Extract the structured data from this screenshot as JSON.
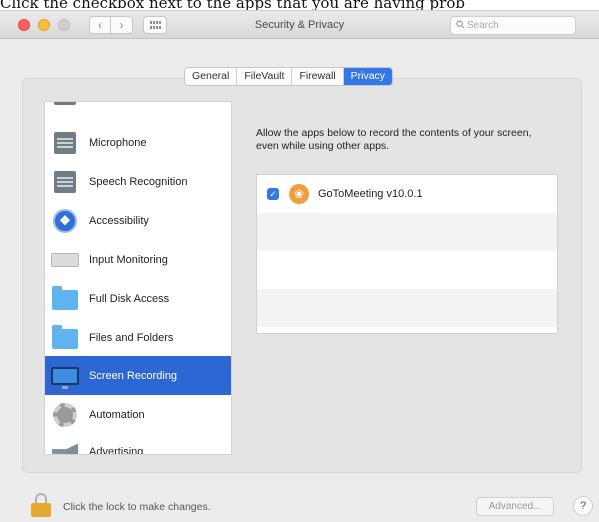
{
  "instruction_text": "Click the checkbox next to the apps that you are having prob",
  "window": {
    "title": "Security & Privacy",
    "search_placeholder": "Search"
  },
  "tabs": [
    {
      "label": "General",
      "selected": false
    },
    {
      "label": "FileVault",
      "selected": false
    },
    {
      "label": "Firewall",
      "selected": false
    },
    {
      "label": "Privacy",
      "selected": true
    }
  ],
  "sidebar": {
    "items": [
      {
        "label": "Microphone",
        "icon": "microphone-icon",
        "selected": false
      },
      {
        "label": "Speech Recognition",
        "icon": "speech-recognition-icon",
        "selected": false
      },
      {
        "label": "Accessibility",
        "icon": "accessibility-icon",
        "selected": false
      },
      {
        "label": "Input Monitoring",
        "icon": "keyboard-icon",
        "selected": false
      },
      {
        "label": "Full Disk Access",
        "icon": "folder-icon",
        "selected": false
      },
      {
        "label": "Files and Folders",
        "icon": "folder-icon",
        "selected": false
      },
      {
        "label": "Screen Recording",
        "icon": "monitor-icon",
        "selected": true
      },
      {
        "label": "Automation",
        "icon": "gear-icon",
        "selected": false
      },
      {
        "label": "Advertising",
        "icon": "megaphone-icon",
        "selected": false
      }
    ]
  },
  "main": {
    "description": "Allow the apps below to record the contents of your screen, even while using other apps.",
    "apps": [
      {
        "name": "GoToMeeting v10.0.1",
        "checked": true,
        "icon": "gotomeeting-icon"
      }
    ]
  },
  "footer": {
    "lock_text": "Click the lock to make changes.",
    "advanced_label": "Advanced...",
    "help_label": "?"
  },
  "colors": {
    "accent": "#3477e6",
    "selection": "#2d67d3"
  }
}
